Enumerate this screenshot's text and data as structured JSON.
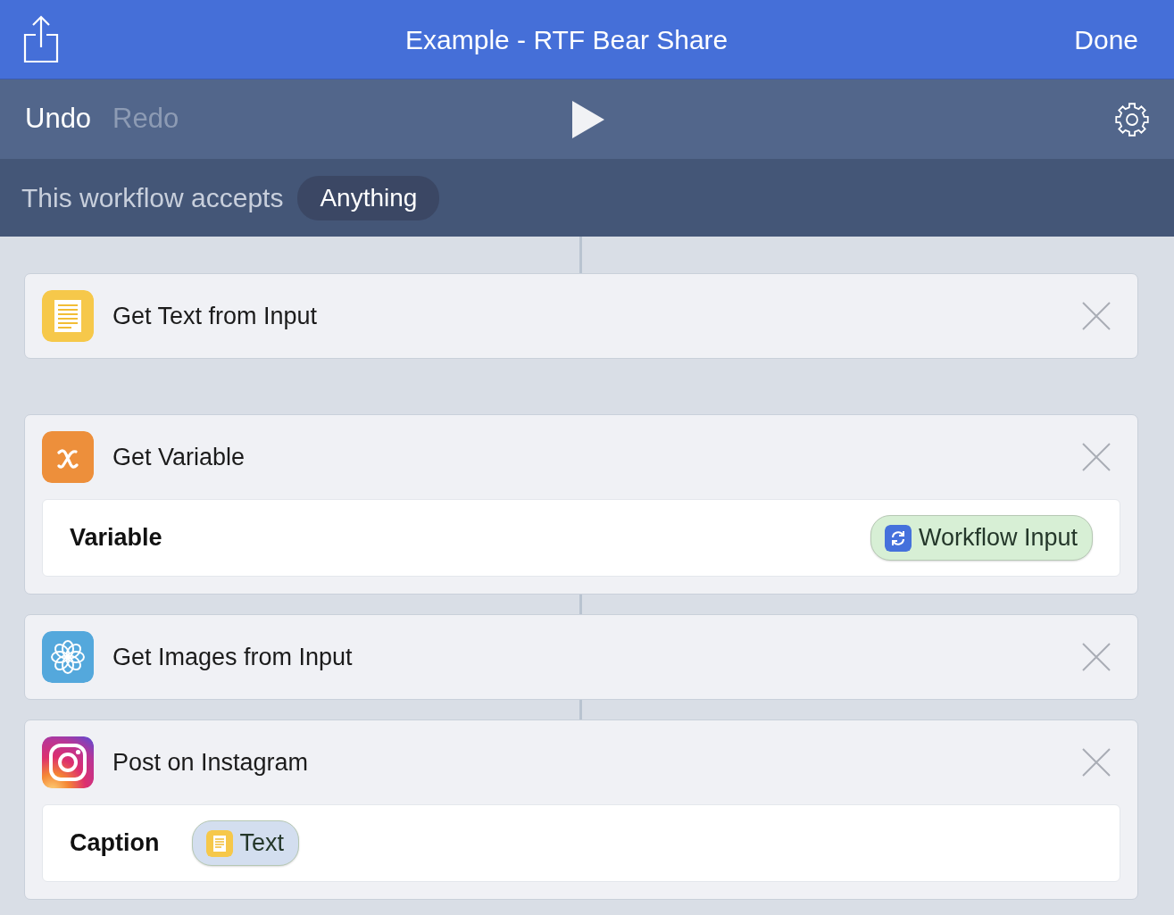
{
  "nav_bar": {
    "title": "Example - RTF Bear Share",
    "done_button": "Done"
  },
  "toolbar": {
    "undo": {
      "label": "Undo",
      "disabled": false
    },
    "redo": {
      "label": "Redo",
      "disabled": true
    }
  },
  "input_bar": {
    "label": "This workflow accepts",
    "value": "Anything"
  },
  "actions": [
    {
      "kind": "text",
      "title": "Get Text from Input",
      "connected": true
    },
    {
      "kind": "variable",
      "title": "Get Variable",
      "connected": false,
      "params": [
        {
          "kind": "picker",
          "label": "Variable",
          "token": {
            "kind": "workflow_input",
            "label": "Workflow Input",
            "color": "#d7efd5"
          }
        }
      ]
    },
    {
      "kind": "images",
      "title": "Get Images from Input",
      "connected": true
    },
    {
      "kind": "instagram",
      "title": "Post on Instagram",
      "connected": true,
      "params": [
        {
          "kind": "field",
          "label": "Caption",
          "token": {
            "kind": "text",
            "label": "Text",
            "color": "#d3deef"
          }
        }
      ]
    }
  ]
}
